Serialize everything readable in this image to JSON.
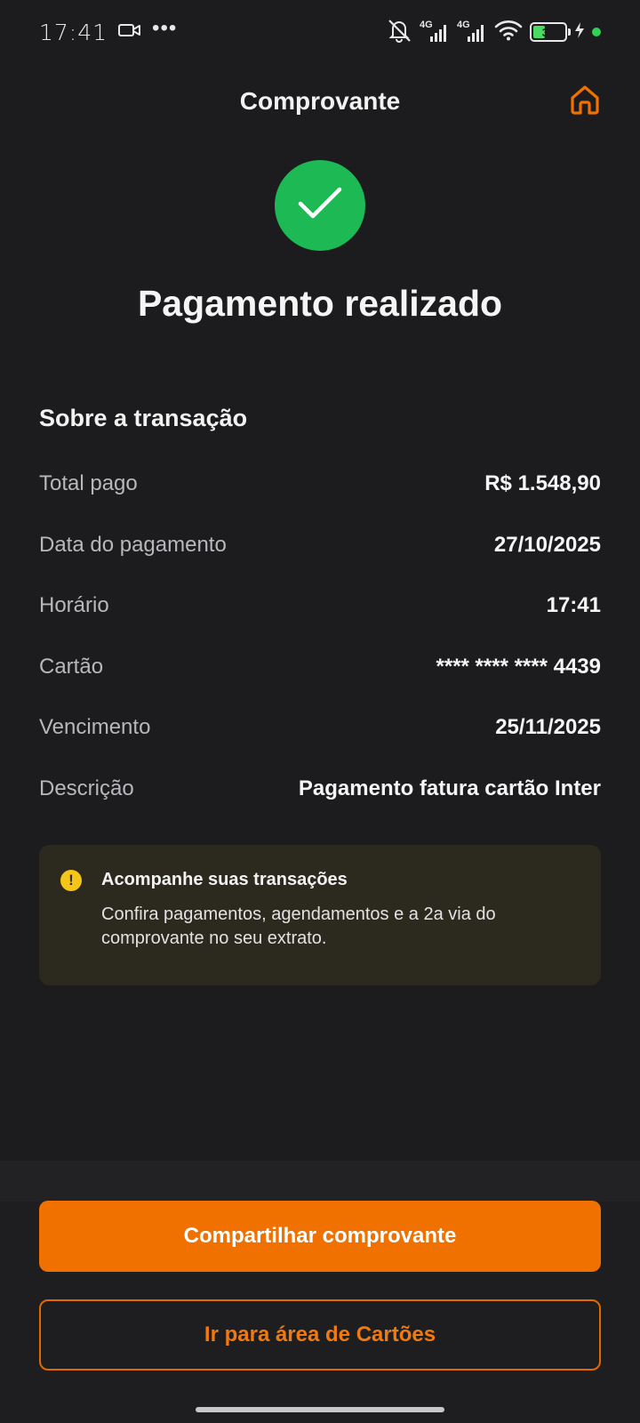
{
  "status_bar": {
    "time": "17:41",
    "more": "•••",
    "signal1_label": "4G",
    "signal2_label": "4G",
    "battery_level": "37",
    "battery_fraction": 0.37
  },
  "header": {
    "title": "Comprovante"
  },
  "success": {
    "title": "Pagamento realizado"
  },
  "transaction": {
    "section_title": "Sobre a transação",
    "rows": [
      {
        "label": "Total pago",
        "value": "R$ 1.548,90"
      },
      {
        "label": "Data do pagamento",
        "value": "27/10/2025"
      },
      {
        "label": "Horário",
        "value": "17:41"
      },
      {
        "label": "Cartão",
        "value": "**** **** **** 4439"
      },
      {
        "label": "Vencimento",
        "value": "25/11/2025"
      },
      {
        "label": "Descrição",
        "value": "Pagamento fatura cartão Inter"
      }
    ]
  },
  "info_card": {
    "icon": "!",
    "title": "Acompanhe suas transações",
    "body": "Confira pagamentos, agendamentos e a 2a via do comprovante no seu extrato."
  },
  "actions": {
    "share_label": "Compartilhar comprovante",
    "cards_label": "Ir para área de Cartões"
  },
  "colors": {
    "accent": "#f07000",
    "success": "#1db954",
    "background": "#1c1c1e",
    "warning": "#f5c518"
  }
}
